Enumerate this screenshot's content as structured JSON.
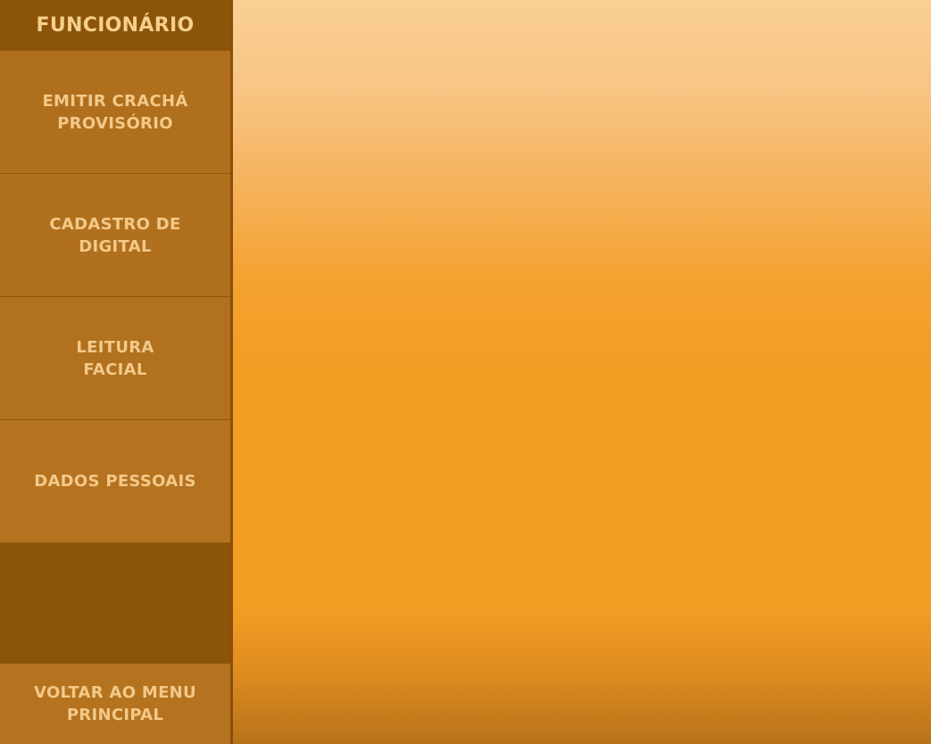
{
  "sidebar": {
    "title": "FUNCIONÁRIO",
    "items": [
      {
        "label": "EMITIR CRACHÁ\nPROVISÓRIO"
      },
      {
        "label": "CADASTRO DE\nDIGITAL"
      },
      {
        "label": "LEITURA\nFACIAL"
      },
      {
        "label": "DADOS PESSOAIS"
      }
    ],
    "back_label": "VOLTAR AO MENU\nPRINCIPAL"
  },
  "colors": {
    "sidebar_dark": "#8c5408",
    "menu_item": "#b2701d",
    "menu_text": "#f3c98a",
    "content_accent": "#f39c24"
  }
}
